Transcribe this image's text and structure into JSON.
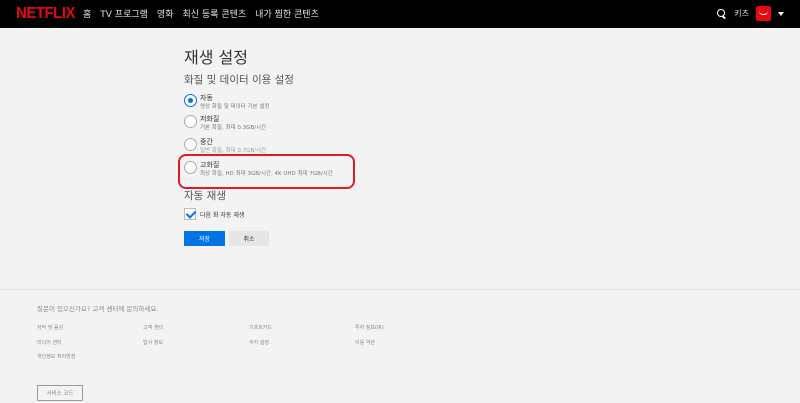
{
  "nav": {
    "logo": "NETFLIX",
    "links": [
      "홈",
      "TV 프로그램",
      "영화",
      "최신 등록 콘텐츠",
      "내가 찜한 콘텐츠"
    ],
    "kids": "키즈",
    "icons": {
      "search": "search-icon",
      "avatar": "profile-avatar",
      "caret": "chevron-down-icon"
    },
    "brand_color": "#e50914"
  },
  "main": {
    "title": "재생 설정",
    "data_section_title": "화질 및 데이터 이용 설정",
    "options": [
      {
        "label": "자동",
        "desc": "영상 화질 및 데이터 기본 설정",
        "checked": true
      },
      {
        "label": "저화질",
        "desc": "기본 화질, 최대 0.3GB/시간",
        "checked": false
      },
      {
        "label": "중간",
        "desc": "일반 화질, 최대 0.7GB/시간",
        "checked": false
      },
      {
        "label": "고화질",
        "desc": "최상 화질, HD 최대 3GB/시간, 4K UHD 최대 7GB/시간",
        "checked": false
      }
    ],
    "autoplay_title": "자동 재생",
    "autoplay_checkbox_label": "다음 화 자동 재생",
    "autoplay_checked": true,
    "save_label": "저장",
    "cancel_label": "취소",
    "accent_color": "#0073e6",
    "highlight_color": "#e01b24"
  },
  "footer": {
    "question": "질문이 있으신가요? 고객 센터에 문의하세요.",
    "links": [
      "자막 및 음성",
      "고객 센터",
      "기프트카드",
      "투자 정보(IR)",
      "미디어 센터",
      "입사 정보",
      "쿠키 설정",
      "이용 약관",
      "개인정보 처리방침"
    ],
    "service_code": "서비스 코드"
  }
}
